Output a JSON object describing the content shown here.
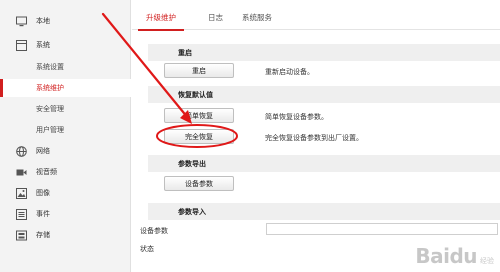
{
  "sidebar": {
    "items": [
      {
        "label": "本地",
        "icon": "monitor-icon"
      },
      {
        "label": "系统",
        "icon": "system-icon"
      },
      {
        "label": "网络",
        "icon": "globe-icon"
      },
      {
        "label": "视音频",
        "icon": "video-audio-icon"
      },
      {
        "label": "图像",
        "icon": "image-icon"
      },
      {
        "label": "事件",
        "icon": "event-icon"
      },
      {
        "label": "存储",
        "icon": "storage-icon"
      }
    ],
    "system_subitems": [
      {
        "label": "系统设置",
        "active": false
      },
      {
        "label": "系统维护",
        "active": true
      },
      {
        "label": "安全管理",
        "active": false
      },
      {
        "label": "用户管理",
        "active": false
      }
    ]
  },
  "tabs": [
    {
      "label": "升级维护",
      "active": true
    },
    {
      "label": "日志",
      "active": false
    },
    {
      "label": "系统服务",
      "active": false
    }
  ],
  "sections": {
    "reboot": {
      "title": "重启",
      "button": "重启",
      "desc": "重新启动设备。"
    },
    "restore": {
      "title": "恢复默认值",
      "simple_button": "简单恢复",
      "simple_desc": "简单恢复设备参数。",
      "full_button": "完全恢复",
      "full_desc": "完全恢复设备参数到出厂设置。"
    },
    "export": {
      "title": "参数导出",
      "button": "设备参数"
    },
    "import": {
      "title": "参数导入",
      "field_label": "设备参数",
      "status_label": "状态"
    }
  },
  "colors": {
    "accent": "#d11f1f",
    "sidebar_bg": "#f3f3f3",
    "section_bg": "#efefef"
  },
  "watermark": {
    "text": "Baidu",
    "sub": "经验"
  }
}
